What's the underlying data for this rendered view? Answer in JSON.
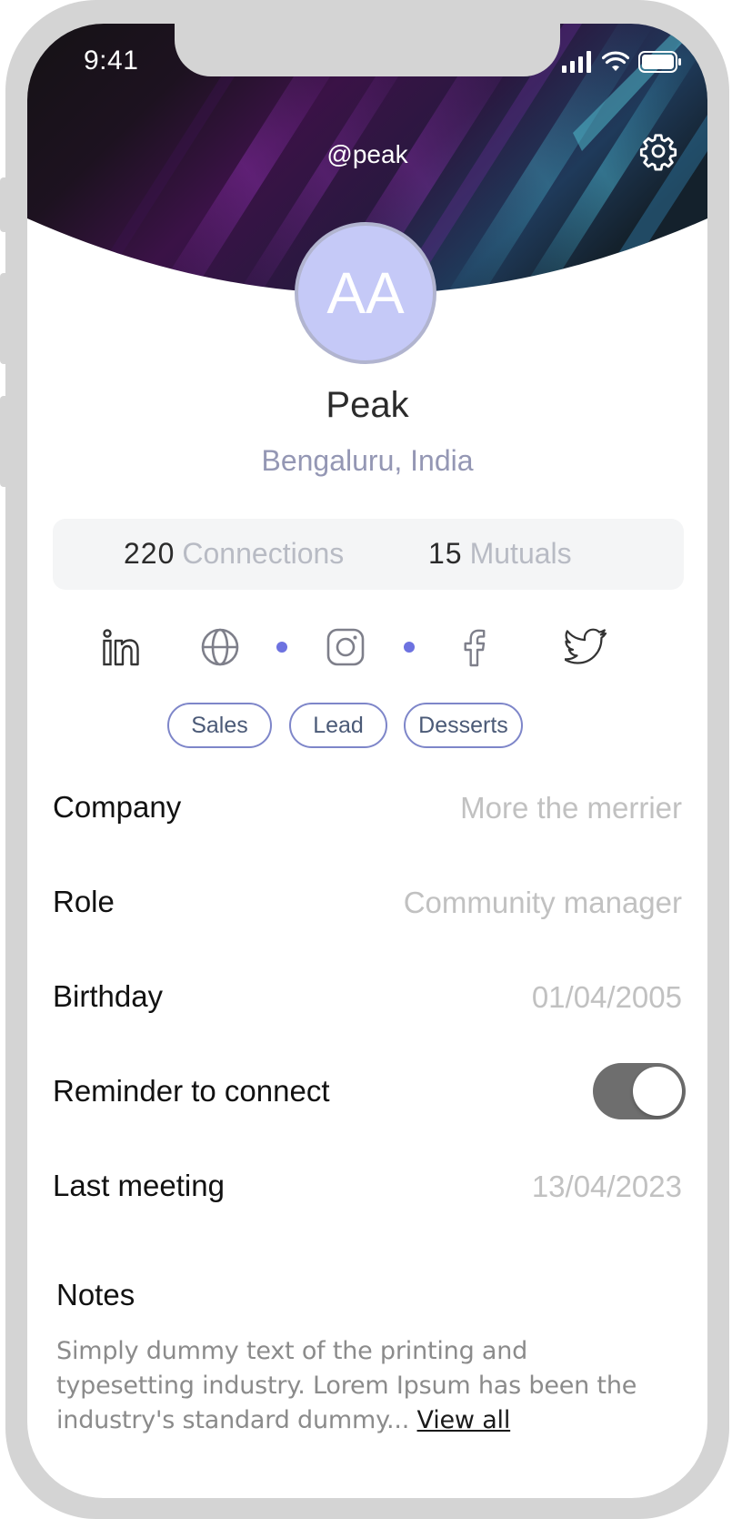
{
  "status_bar": {
    "time": "9:41"
  },
  "header": {
    "handle": "@peak"
  },
  "profile": {
    "initials": "AA",
    "name": "Peak",
    "location": "Bengaluru, India"
  },
  "stats": {
    "connections_count": "220",
    "connections_label": "Connections",
    "mutuals_count": "15",
    "mutuals_label": "Mutuals"
  },
  "socials": [
    "linkedin-icon",
    "globe-icon",
    "instagram-icon",
    "facebook-icon",
    "twitter-icon"
  ],
  "tags": [
    "Sales",
    "Lead",
    "Desserts"
  ],
  "details": {
    "company_label": "Company",
    "company_value": "More the merrier",
    "role_label": "Role",
    "role_value": "Community manager",
    "birthday_label": "Birthday",
    "birthday_value": "01/04/2005",
    "reminder_label": "Reminder to connect",
    "reminder_on": true,
    "last_meeting_label": "Last meeting",
    "last_meeting_value": "13/04/2023"
  },
  "notes": {
    "title": "Notes",
    "text": "Simply dummy text of the printing and typesetting industry. Lorem Ipsum has been the industry's standard dummy...",
    "view_all": "View all"
  },
  "colors": {
    "accent": "#6d72e0",
    "avatar_bg": "#c5c9f7",
    "tag_border": "#7e86c9",
    "location_text": "#9497b4"
  }
}
